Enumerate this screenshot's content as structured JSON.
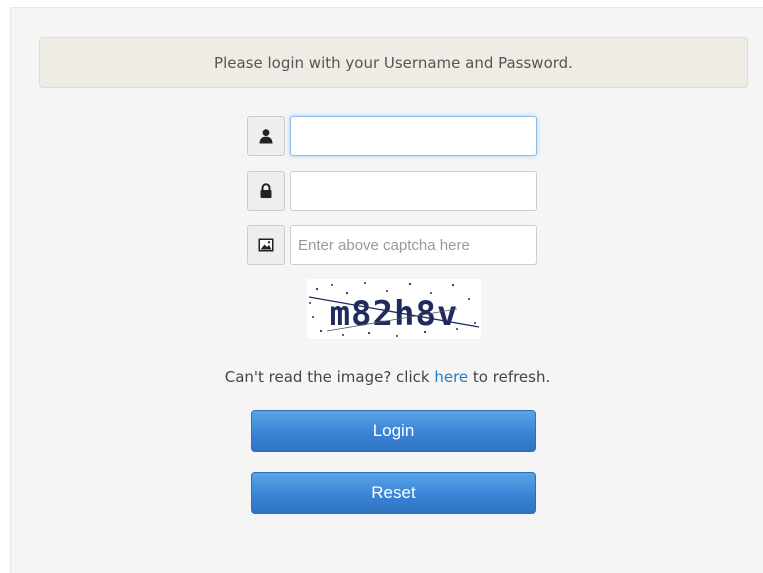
{
  "notice": {
    "text": "Please login with your Username and Password."
  },
  "username": {
    "value": "",
    "placeholder": "",
    "icon": "user-icon"
  },
  "password": {
    "value": "",
    "placeholder": "",
    "icon": "lock-icon"
  },
  "captcha_field": {
    "value": "",
    "placeholder": "Enter above captcha here",
    "icon": "image-icon"
  },
  "captcha_image": {
    "text": "m82h8v"
  },
  "refresh": {
    "prefix": "Can't read the image? click ",
    "link": "here",
    "suffix": " to refresh."
  },
  "buttons": {
    "login": "Login",
    "reset": "Reset"
  },
  "colors": {
    "accent": "#3a84d6",
    "link": "#2a7bc4",
    "notice_bg": "#eeece4"
  }
}
